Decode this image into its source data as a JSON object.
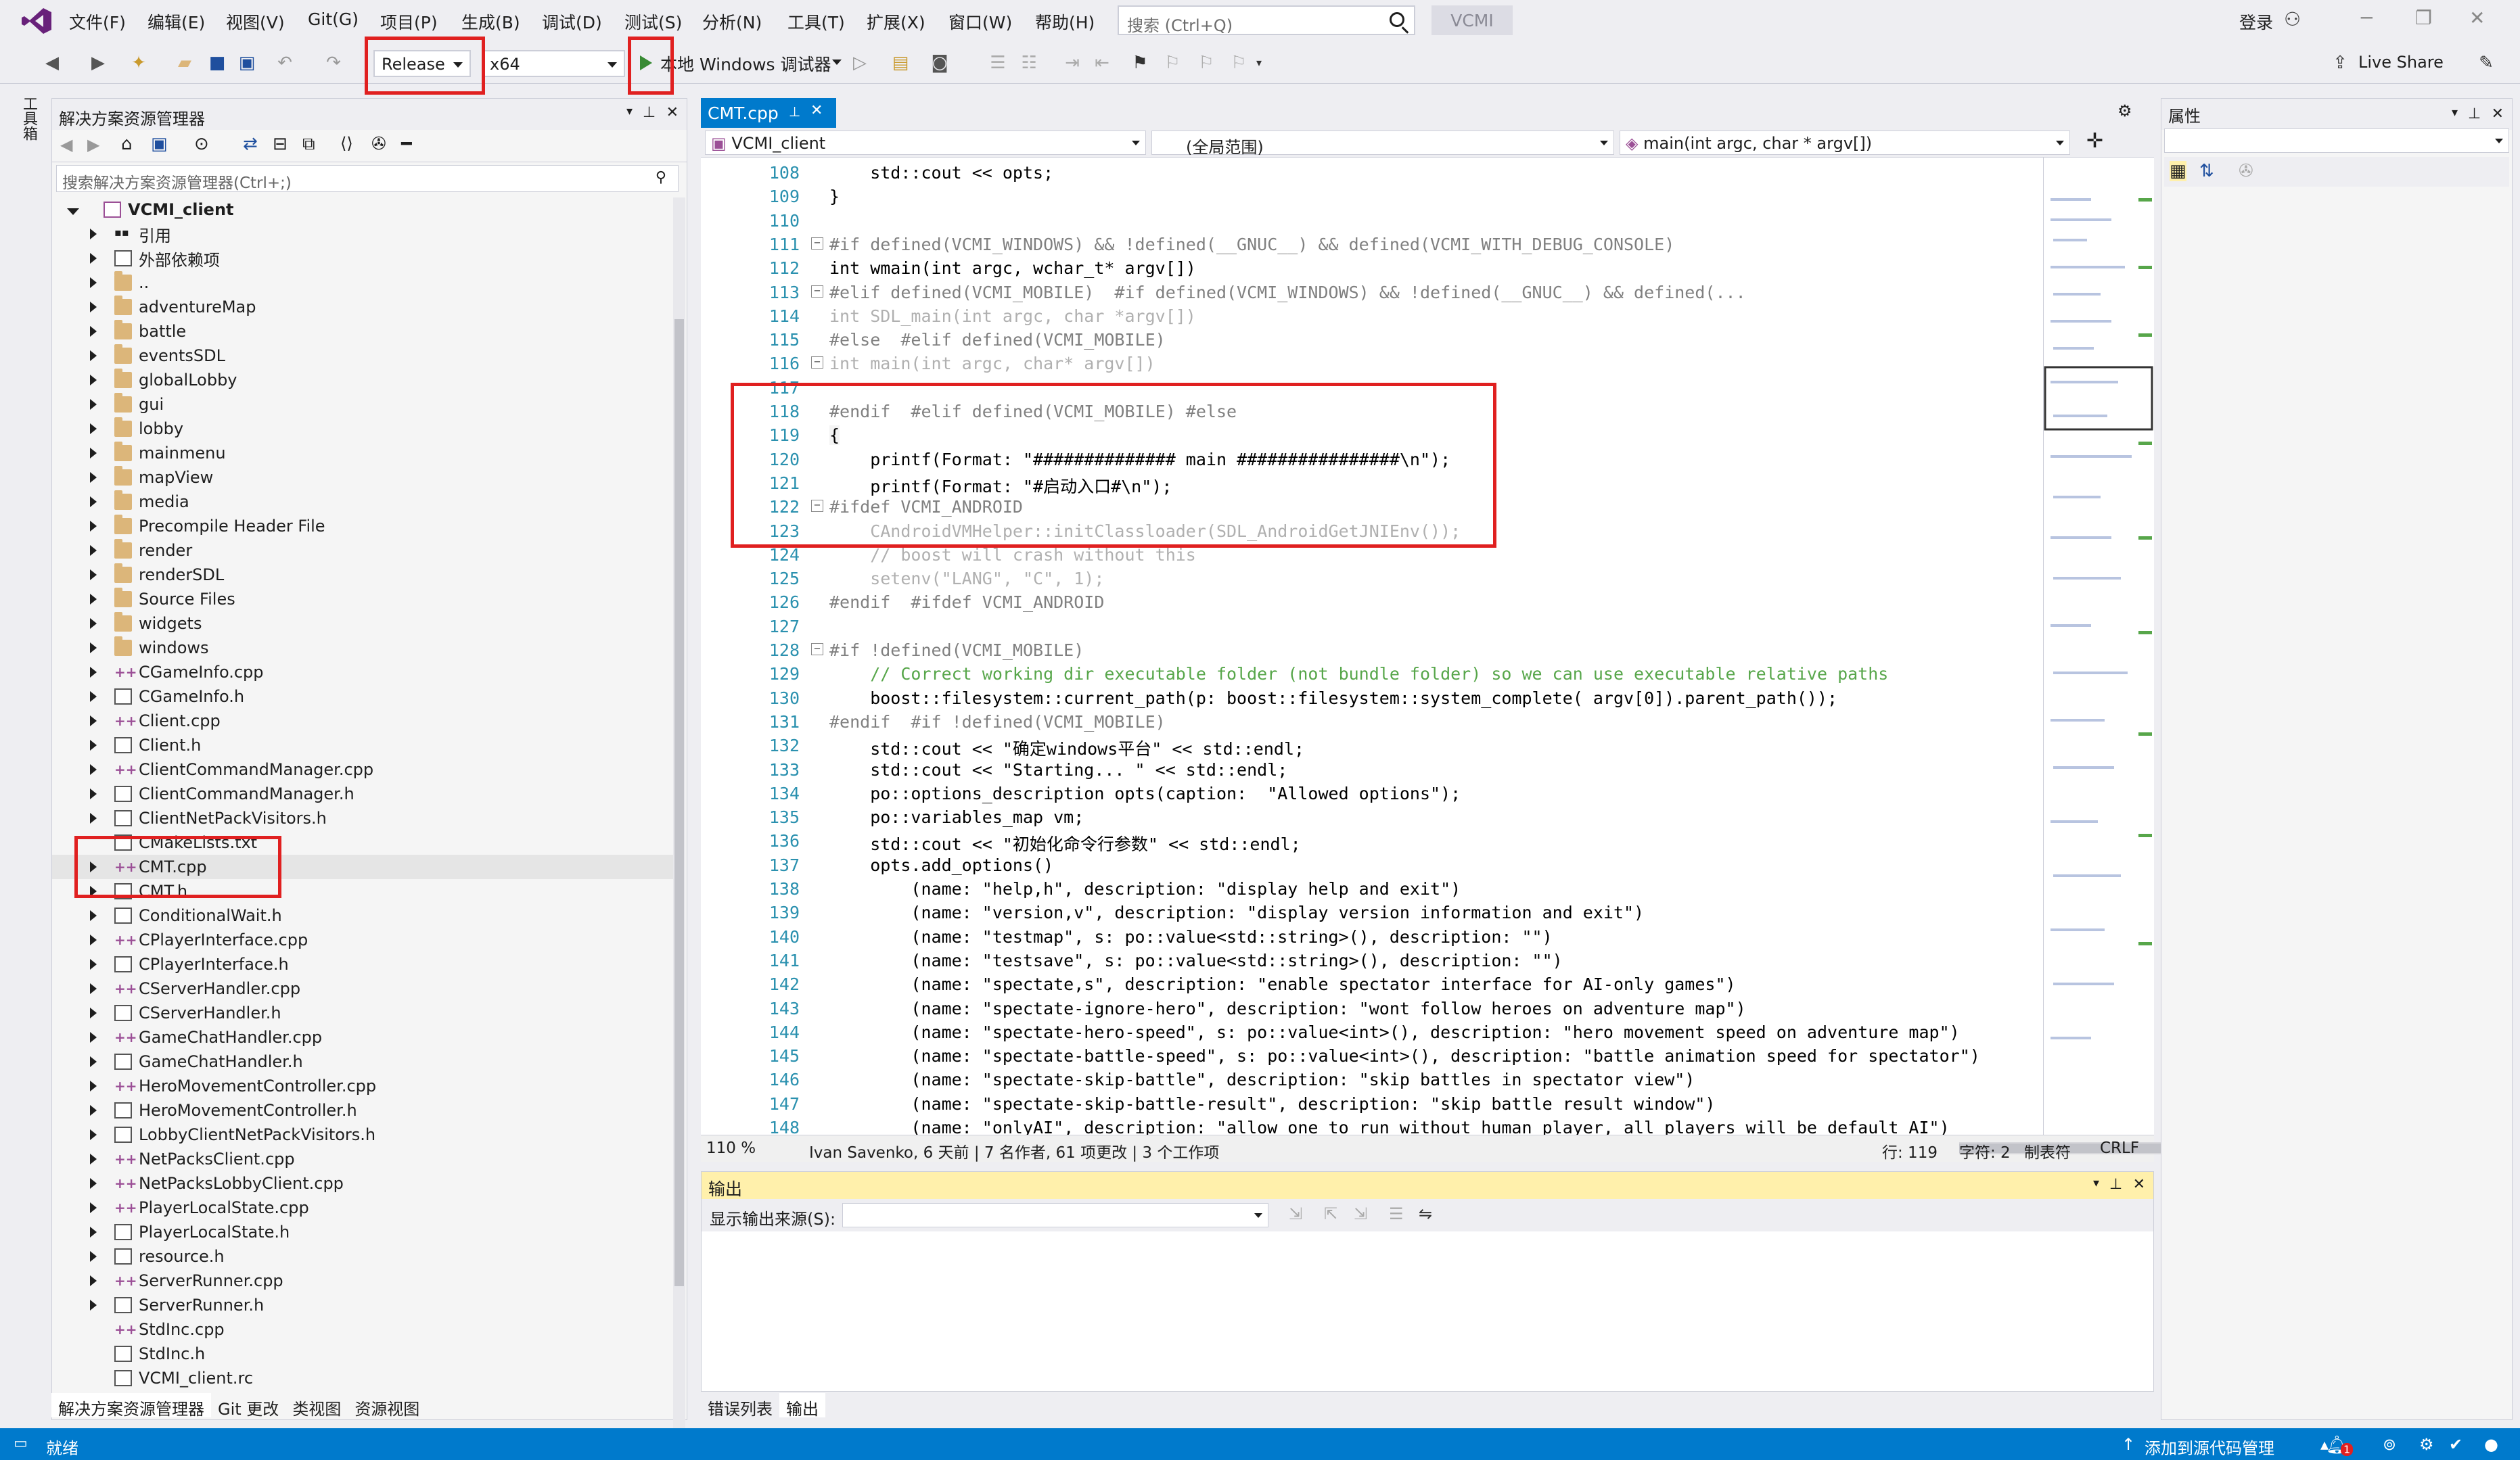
{
  "app": {
    "name": "VCMI",
    "search_placeholder": "搜索 (Ctrl+Q)",
    "login": "登录",
    "live_share": "Live Share"
  },
  "menu": [
    "文件(F)",
    "编辑(E)",
    "视图(V)",
    "Git(G)",
    "项目(P)",
    "生成(B)",
    "调试(D)",
    "测试(S)",
    "分析(N)",
    "工具(T)",
    "扩展(X)",
    "窗口(W)",
    "帮助(H)"
  ],
  "toolbar": {
    "config": "Release",
    "platform": "x64",
    "run_label": "本地 Windows 调试器"
  },
  "left_strip_label": "工具箱",
  "solution_explorer": {
    "title": "解决方案资源管理器",
    "search_placeholder": "搜索解决方案资源管理器(Ctrl+;)",
    "root": "VCMI_client",
    "items": [
      {
        "label": "引用",
        "type": "ref"
      },
      {
        "label": "外部依赖项",
        "type": "ext"
      },
      {
        "label": "..",
        "type": "folder"
      },
      {
        "label": "adventureMap",
        "type": "folder"
      },
      {
        "label": "battle",
        "type": "folder"
      },
      {
        "label": "eventsSDL",
        "type": "folder"
      },
      {
        "label": "globalLobby",
        "type": "folder"
      },
      {
        "label": "gui",
        "type": "folder"
      },
      {
        "label": "lobby",
        "type": "folder"
      },
      {
        "label": "mainmenu",
        "type": "folder"
      },
      {
        "label": "mapView",
        "type": "folder"
      },
      {
        "label": "media",
        "type": "folder"
      },
      {
        "label": "Precompile Header File",
        "type": "folder"
      },
      {
        "label": "render",
        "type": "folder"
      },
      {
        "label": "renderSDL",
        "type": "folder"
      },
      {
        "label": "Source Files",
        "type": "folder"
      },
      {
        "label": "widgets",
        "type": "folder"
      },
      {
        "label": "windows",
        "type": "folder"
      },
      {
        "label": "CGameInfo.cpp",
        "type": "cpp"
      },
      {
        "label": "CGameInfo.h",
        "type": "h"
      },
      {
        "label": "Client.cpp",
        "type": "cpp"
      },
      {
        "label": "Client.h",
        "type": "h"
      },
      {
        "label": "ClientCommandManager.cpp",
        "type": "cpp"
      },
      {
        "label": "ClientCommandManager.h",
        "type": "h"
      },
      {
        "label": "ClientNetPackVisitors.h",
        "type": "h"
      },
      {
        "label": "CMakeLists.txt",
        "type": "txt"
      },
      {
        "label": "CMT.cpp",
        "type": "cpp"
      },
      {
        "label": "CMT.h",
        "type": "h"
      },
      {
        "label": "ConditionalWait.h",
        "type": "h"
      },
      {
        "label": "CPlayerInterface.cpp",
        "type": "cpp"
      },
      {
        "label": "CPlayerInterface.h",
        "type": "h"
      },
      {
        "label": "CServerHandler.cpp",
        "type": "cpp"
      },
      {
        "label": "CServerHandler.h",
        "type": "h"
      },
      {
        "label": "GameChatHandler.cpp",
        "type": "cpp"
      },
      {
        "label": "GameChatHandler.h",
        "type": "h"
      },
      {
        "label": "HeroMovementController.cpp",
        "type": "cpp"
      },
      {
        "label": "HeroMovementController.h",
        "type": "h"
      },
      {
        "label": "LobbyClientNetPackVisitors.h",
        "type": "h"
      },
      {
        "label": "NetPacksClient.cpp",
        "type": "cpp"
      },
      {
        "label": "NetPacksLobbyClient.cpp",
        "type": "cpp"
      },
      {
        "label": "PlayerLocalState.cpp",
        "type": "cpp"
      },
      {
        "label": "PlayerLocalState.h",
        "type": "h"
      },
      {
        "label": "resource.h",
        "type": "h"
      },
      {
        "label": "ServerRunner.cpp",
        "type": "cpp"
      },
      {
        "label": "ServerRunner.h",
        "type": "h"
      },
      {
        "label": "StdInc.cpp",
        "type": "cpp"
      },
      {
        "label": "StdInc.h",
        "type": "h"
      },
      {
        "label": "VCMI_client.rc",
        "type": "rc"
      }
    ],
    "bottom_tabs": [
      "解决方案资源管理器",
      "Git 更改",
      "类视图",
      "资源视图"
    ]
  },
  "editor": {
    "tab": "CMT.cpp",
    "nav_project": "VCMI_client",
    "nav_scope": "(全局范围)",
    "nav_function": "main(int argc, char * argv[])",
    "lines": [
      {
        "n": "108",
        "t": "    std::cout << opts;"
      },
      {
        "n": "109",
        "t": "}"
      },
      {
        "n": "110",
        "t": ""
      },
      {
        "n": "111",
        "t": "#if defined(VCMI_WINDOWS) && !defined(__GNUC__) && defined(VCMI_WITH_DEBUG_CONSOLE)"
      },
      {
        "n": "112",
        "t": "int wmain(int argc, wchar_t* argv[])"
      },
      {
        "n": "113",
        "t": "#elif defined(VCMI_MOBILE)  #if defined(VCMI_WINDOWS) && !defined(__GNUC__) && defined(..."
      },
      {
        "n": "114",
        "t": "int SDL_main(int argc, char *argv[])"
      },
      {
        "n": "115",
        "t": "#else  #elif defined(VCMI_MOBILE)"
      },
      {
        "n": "116",
        "t": "int main(int argc, char* argv[])"
      },
      {
        "n": "117",
        "t": ""
      },
      {
        "n": "118",
        "t": "#endif  #elif defined(VCMI_MOBILE) #else"
      },
      {
        "n": "119",
        "t": "{"
      },
      {
        "n": "120",
        "t": "    printf(Format: \"############## main ################\\n\");"
      },
      {
        "n": "121",
        "t": "    printf(Format: \"#启动入口#\\n\");"
      },
      {
        "n": "122",
        "t": "#ifdef VCMI_ANDROID"
      },
      {
        "n": "123",
        "t": "    CAndroidVMHelper::initClassloader(SDL_AndroidGetJNIEnv());"
      },
      {
        "n": "124",
        "t": "    // boost will crash without this"
      },
      {
        "n": "125",
        "t": "    setenv(\"LANG\", \"C\", 1);"
      },
      {
        "n": "126",
        "t": "#endif  #ifdef VCMI_ANDROID"
      },
      {
        "n": "127",
        "t": ""
      },
      {
        "n": "128",
        "t": "#if !defined(VCMI_MOBILE)"
      },
      {
        "n": "129",
        "t": "    // Correct working dir executable folder (not bundle folder) so we can use executable relative paths"
      },
      {
        "n": "130",
        "t": "    boost::filesystem::current_path(p: boost::filesystem::system_complete( argv[0]).parent_path());"
      },
      {
        "n": "131",
        "t": "#endif  #if !defined(VCMI_MOBILE)"
      },
      {
        "n": "132",
        "t": "    std::cout << \"确定windows平台\" << std::endl;"
      },
      {
        "n": "133",
        "t": "    std::cout << \"Starting... \" << std::endl;"
      },
      {
        "n": "134",
        "t": "    po::options_description opts(caption:  \"Allowed options\");"
      },
      {
        "n": "135",
        "t": "    po::variables_map vm;"
      },
      {
        "n": "136",
        "t": "    std::cout << \"初始化命令行参数\" << std::endl;"
      },
      {
        "n": "137",
        "t": "    opts.add_options()"
      },
      {
        "n": "138",
        "t": "        (name: \"help,h\", description: \"display help and exit\")"
      },
      {
        "n": "139",
        "t": "        (name: \"version,v\", description: \"display version information and exit\")"
      },
      {
        "n": "140",
        "t": "        (name: \"testmap\", s: po::value<std::string>(), description: \"\")"
      },
      {
        "n": "141",
        "t": "        (name: \"testsave\", s: po::value<std::string>(), description: \"\")"
      },
      {
        "n": "142",
        "t": "        (name: \"spectate,s\", description: \"enable spectator interface for AI-only games\")"
      },
      {
        "n": "143",
        "t": "        (name: \"spectate-ignore-hero\", description: \"wont follow heroes on adventure map\")"
      },
      {
        "n": "144",
        "t": "        (name: \"spectate-hero-speed\", s: po::value<int>(), description: \"hero movement speed on adventure map\")"
      },
      {
        "n": "145",
        "t": "        (name: \"spectate-battle-speed\", s: po::value<int>(), description: \"battle animation speed for spectator\")"
      },
      {
        "n": "146",
        "t": "        (name: \"spectate-skip-battle\", description: \"skip battles in spectator view\")"
      },
      {
        "n": "147",
        "t": "        (name: \"spectate-skip-battle-result\", description: \"skip battle result window\")"
      },
      {
        "n": "148",
        "t": "        (name: \"onlyAI\", description: \"allow one to run without human player, all players will be default AI\")"
      }
    ],
    "status": {
      "zoom": "110 %",
      "git": "Ivan Savenko, 6 天前 | 7 名作者, 61 项更改 | 3 个工作项",
      "line": "行: 119",
      "char": "字符: 2",
      "tabs": "制表符",
      "eol": "CRLF"
    }
  },
  "output": {
    "title": "输出",
    "source_label": "显示输出来源(S):",
    "bottom_tabs": [
      "错误列表",
      "输出"
    ]
  },
  "properties": {
    "title": "属性"
  },
  "statusbar": {
    "ready": "就绪",
    "source_control": "添加到源代码管理",
    "notifications": "1"
  },
  "colors": {
    "accent": "#007acc",
    "highlight_box": "#e02020",
    "output_head": "#fff0ab"
  }
}
